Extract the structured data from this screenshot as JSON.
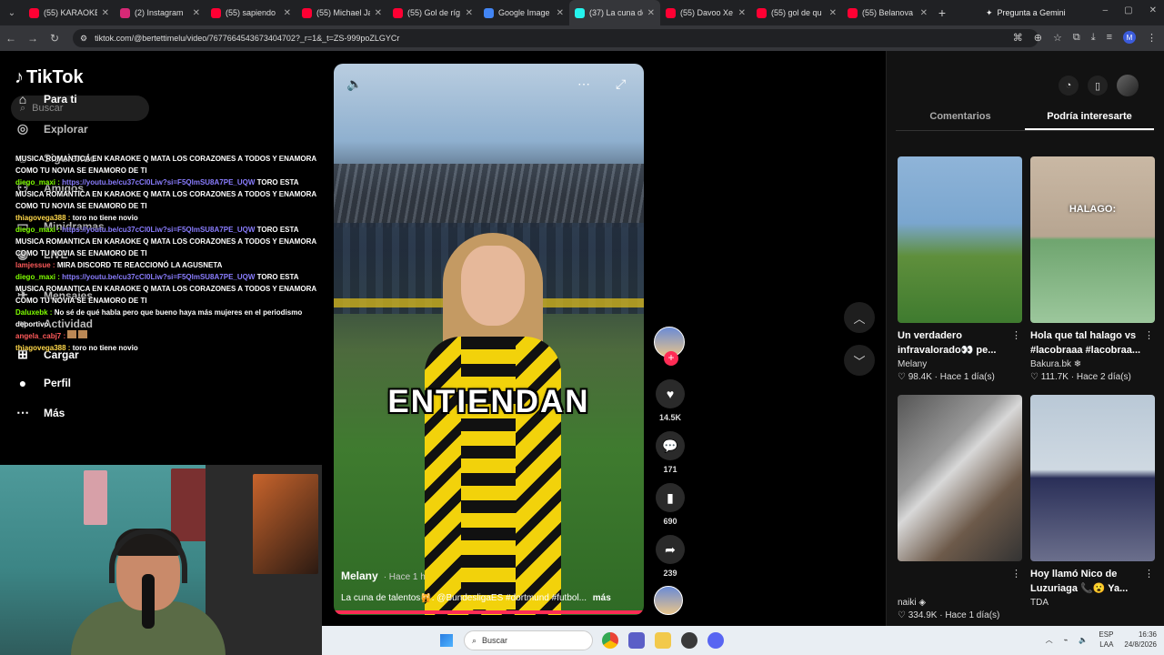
{
  "browser": {
    "tabs": [
      {
        "title": "(55) KARAOKE",
        "fav": "#ff0033"
      },
      {
        "title": "(2) Instagram",
        "fav": "#d62976"
      },
      {
        "title": "(55) sapiendo",
        "fav": "#ff0033"
      },
      {
        "title": "(55) Michael Ja",
        "fav": "#ff0033"
      },
      {
        "title": "(55) Gol de ríg",
        "fav": "#ff0033"
      },
      {
        "title": "Google Image",
        "fav": "#4285f4"
      },
      {
        "title": "(37) La cuna de",
        "fav": "#25f4ee",
        "active": true
      },
      {
        "title": "(55) Davoo Xe",
        "fav": "#ff0033"
      },
      {
        "title": "(55) gol de qu",
        "fav": "#ff0033"
      },
      {
        "title": "(55) Belanova",
        "fav": "#ff0033"
      }
    ],
    "gemini_label": "Pregunta a Gemini",
    "url": "tiktok.com/@bertettimelu/video/7677664543673404702?_r=1&_t=ZS-999poZLGYCr",
    "profile_initial": "M"
  },
  "sidebar": {
    "logo": "TikTok",
    "search_placeholder": "Buscar",
    "nav": [
      {
        "label": "Para ti",
        "icon": "home-icon",
        "glyph": "⌂"
      },
      {
        "label": "Explorar",
        "icon": "compass-icon",
        "glyph": "◎"
      },
      {
        "label": "Siguiendo",
        "icon": "following-icon",
        "glyph": "☺"
      },
      {
        "label": "Amigos",
        "icon": "friends-icon",
        "glyph": "⚇"
      },
      {
        "label": "Minidramas",
        "icon": "minidrama-icon",
        "glyph": "▭"
      },
      {
        "label": "LIVE",
        "icon": "live-icon",
        "glyph": "◉"
      },
      {
        "label": "Mensajes",
        "icon": "messages-icon",
        "glyph": "✈"
      },
      {
        "label": "Actividad",
        "icon": "activity-icon",
        "glyph": "♥"
      },
      {
        "label": "Cargar",
        "icon": "upload-icon",
        "glyph": "⊞"
      },
      {
        "label": "Perfil",
        "icon": "profile-icon",
        "glyph": "●"
      },
      {
        "label": "Más",
        "icon": "more-icon",
        "glyph": "⋯"
      }
    ]
  },
  "chat": [
    {
      "user": "",
      "text": "MUSICA ROMANTICA EN KARAOKE Q MATA LOS CORAZONES A TODOS Y ENAMORA COMO TU NOVIA SE ENAMORO DE TI",
      "cls": ""
    },
    {
      "user": "diego_maxi :",
      "link": "https://youtu.be/cu37cCl0Liw?si=F5QlmSU8A7PE_UQW",
      "text": "TORO ESTA MUSICA ROMANTICA EN KARAOKE Q MATA LOS CORAZONES A TODOS Y ENAMORA COMO TU NOVIA SE ENAMORO DE TI",
      "cls": "u1"
    },
    {
      "user": "thiagovega388 :",
      "text": "toro no tiene novio",
      "cls": "u2"
    },
    {
      "user": "diego_maxi :",
      "link": "https://youtu.be/cu37cCl0Liw?si=F5QlmSU8A7PE_UQW",
      "text": "TORO ESTA MUSICA ROMANTICA EN KARAOKE Q MATA LOS CORAZONES A TODOS Y ENAMORA COMO TU NOVIA SE ENAMORO DE TI",
      "cls": "u1"
    },
    {
      "user": "lamjessue :",
      "text": "MIRA DISCORD TE REACCIONÓ LA AGUSNETA",
      "cls": "u3"
    },
    {
      "user": "diego_maxi :",
      "link": "https://youtu.be/cu37cCl0Liw?si=F5QlmSU8A7PE_UQW",
      "text": "TORO ESTA MUSICA ROMANTICA EN KARAOKE Q MATA LOS CORAZONES A TODOS Y ENAMORA COMO TU NOVIA SE ENAMORO DE TI",
      "cls": "u1"
    },
    {
      "user": "Daluxebk :",
      "text": "No sé de qué habla pero que bueno haya más mujeres en el periodismo deportivo",
      "cls": "u1"
    },
    {
      "user": "angela_cabj7 :",
      "text": "",
      "cls": "u3"
    },
    {
      "user": "thiagovega388 :",
      "text": "toro no tiene novio",
      "cls": "u2"
    }
  ],
  "video": {
    "caption_overlay": "ENTIENDAN",
    "author": "Melany",
    "time": "· Hace 1 h",
    "description": "La cuna de talentos🙀. @BundesligaES #dortmund #futbol...",
    "more": "más"
  },
  "actions": {
    "likes": "14.5K",
    "comments": "171",
    "saves": "690",
    "shares": "239"
  },
  "right": {
    "tabs": [
      "Comentarios",
      "Podría interesarte"
    ],
    "cards": [
      {
        "title": "Un verdadero infravalorado👀 pe...",
        "user": "Melany",
        "likes": "♡ 98.4K",
        "time": "· Hace 1 día(s)",
        "label": "",
        "bg": "linear-gradient(180deg,#8fb4d8 0%,#7aa6cf 40%,#5f8f3c 60%,#3f7b2f 100%)"
      },
      {
        "title": "Hola que tal halago vs #lacobraaa #lacobraa...",
        "user": "Bakura.bk ❄",
        "likes": "♡ 111.7K",
        "time": "· Hace 2 día(s)",
        "label": "HALAGO:",
        "bg": "linear-gradient(180deg,#c9b8a4 0%,#b7a591 48%,#6fa56f 50%,#9cc79c 100%)"
      },
      {
        "title": "",
        "user": "naiki ◈",
        "likes": "♡ 334.9K",
        "time": "· Hace 1 día(s)",
        "label": "",
        "bg": "linear-gradient(135deg,#555 0%,#999 35%,#d8d8d8 45%,#6d5a4a 70%,#333 100%)"
      },
      {
        "title": "Hoy llamó Nico de Luzuriaga 📞😮 Ya...",
        "user": "TDA",
        "likes": "",
        "time": "",
        "label": "",
        "bg": "linear-gradient(180deg,#b9c8d6 0%,#cfd9e2 45%,#2a2f58 50%,#6b6f8c 100%)"
      }
    ]
  },
  "taskbar": {
    "search": "Buscar",
    "lang1": "ESP",
    "lang2": "LAA",
    "time": "16:36",
    "date": "24/8/2026"
  }
}
